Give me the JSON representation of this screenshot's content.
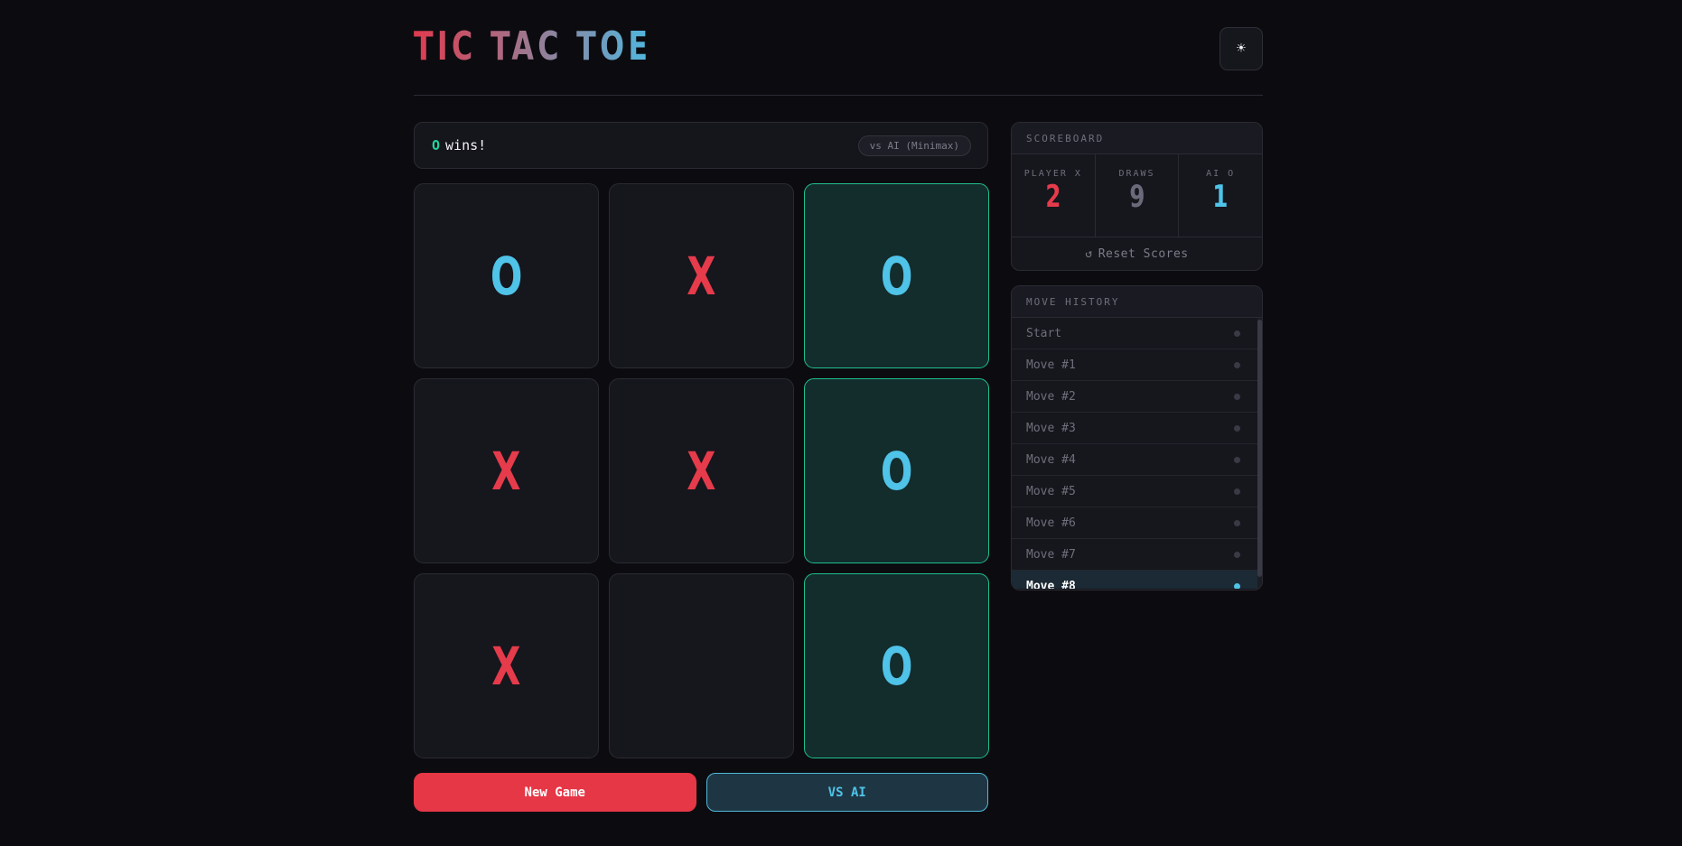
{
  "header": {
    "title": "TIC TAC TOE",
    "theme_icon": "sun-icon",
    "theme_glyph": "☀"
  },
  "status": {
    "winner": "O",
    "text": "wins!",
    "mode": "vs AI (Minimax)"
  },
  "board": {
    "cells": [
      "O",
      "X",
      "O",
      "X",
      "X",
      "O",
      "X",
      "",
      "O"
    ],
    "winning_cells": [
      2,
      5,
      8
    ]
  },
  "controls": {
    "new_game": "New Game",
    "vs_ai": "VS AI"
  },
  "scoreboard": {
    "title": "SCOREBOARD",
    "player_x_label": "PLAYER X",
    "player_x_score": "2",
    "draws_label": "DRAWS",
    "draws_score": "9",
    "ai_o_label": "AI O",
    "ai_o_score": "1",
    "reset_icon": "reset-icon",
    "reset_glyph": "↺",
    "reset_label": "Reset Scores"
  },
  "history": {
    "title": "MOVE HISTORY",
    "items": [
      {
        "label": "Start",
        "active": false
      },
      {
        "label": "Move #1",
        "active": false
      },
      {
        "label": "Move #2",
        "active": false
      },
      {
        "label": "Move #3",
        "active": false
      },
      {
        "label": "Move #4",
        "active": false
      },
      {
        "label": "Move #5",
        "active": false
      },
      {
        "label": "Move #6",
        "active": false
      },
      {
        "label": "Move #7",
        "active": false
      },
      {
        "label": "Move #8",
        "active": true
      }
    ]
  },
  "colors": {
    "x": "#e53b4b",
    "o": "#4fc3e8",
    "win_border": "#1fc08e",
    "accent_red": "#e63746"
  }
}
